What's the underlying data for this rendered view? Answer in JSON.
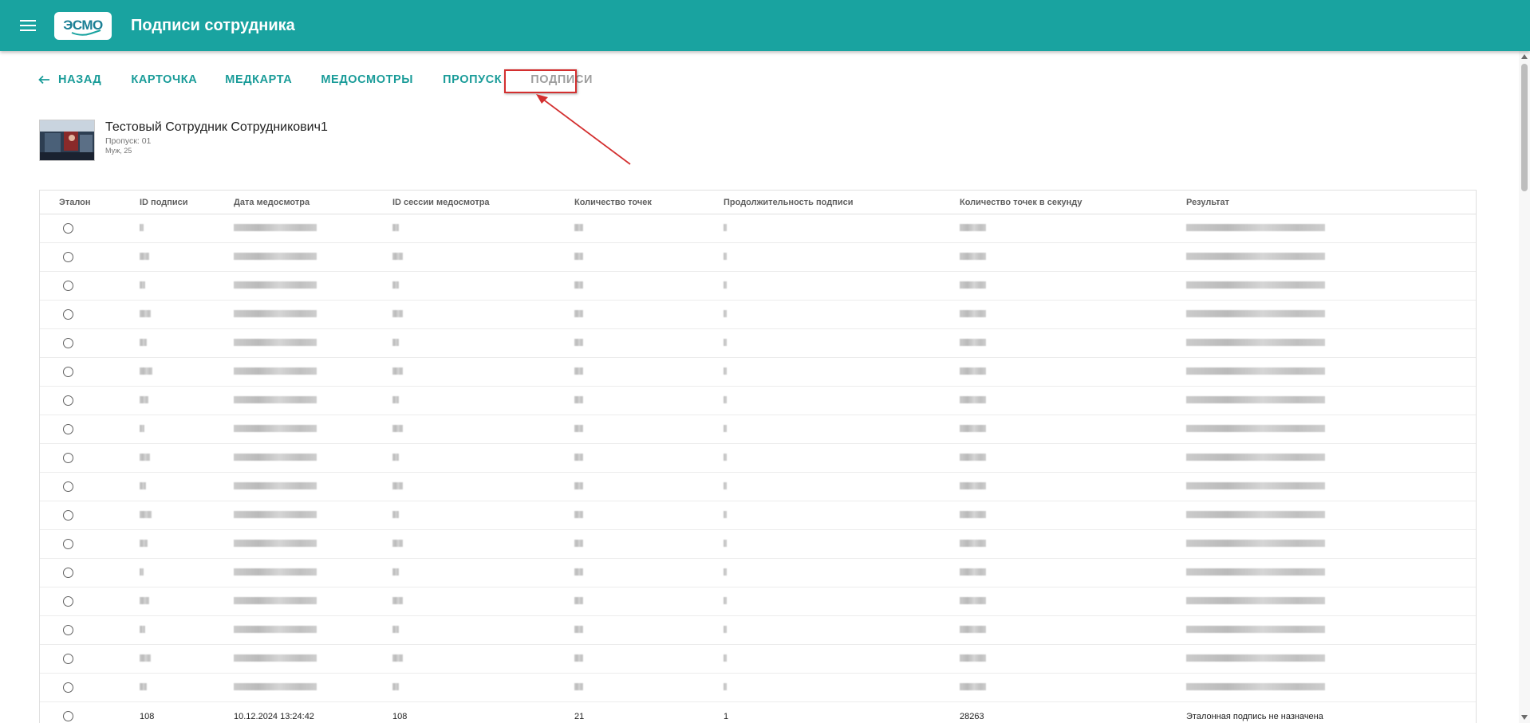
{
  "header": {
    "logo_text": "ЭСМО",
    "title": "Подписи сотрудника",
    "color": "#19a3a0"
  },
  "tabs": [
    {
      "label": "НАЗАД",
      "icon": "arrow-left-icon"
    },
    {
      "label": "КАРТОЧКА"
    },
    {
      "label": "МЕДКАРТА"
    },
    {
      "label": "МЕДОСМОТРЫ"
    },
    {
      "label": "ПРОПУСК"
    },
    {
      "label": "ПОДПИСИ",
      "active": true
    }
  ],
  "employee": {
    "name": "Тестовый Сотрудник Сотрудникович1",
    "pass": "Пропуск: 01",
    "meta": "Муж, 25"
  },
  "table": {
    "columns": [
      "Эталон",
      "ID подписи",
      "Дата медосмотра",
      "ID сессии медосмотра",
      "Количество точек",
      "Продолжительность подписи",
      "Количество точек в секунду",
      "Результат"
    ],
    "last_row": [
      "108",
      "10.12.2024 13:24:42",
      "108",
      "21",
      "1",
      "28263",
      "Эталонная подпись не назначена"
    ]
  }
}
